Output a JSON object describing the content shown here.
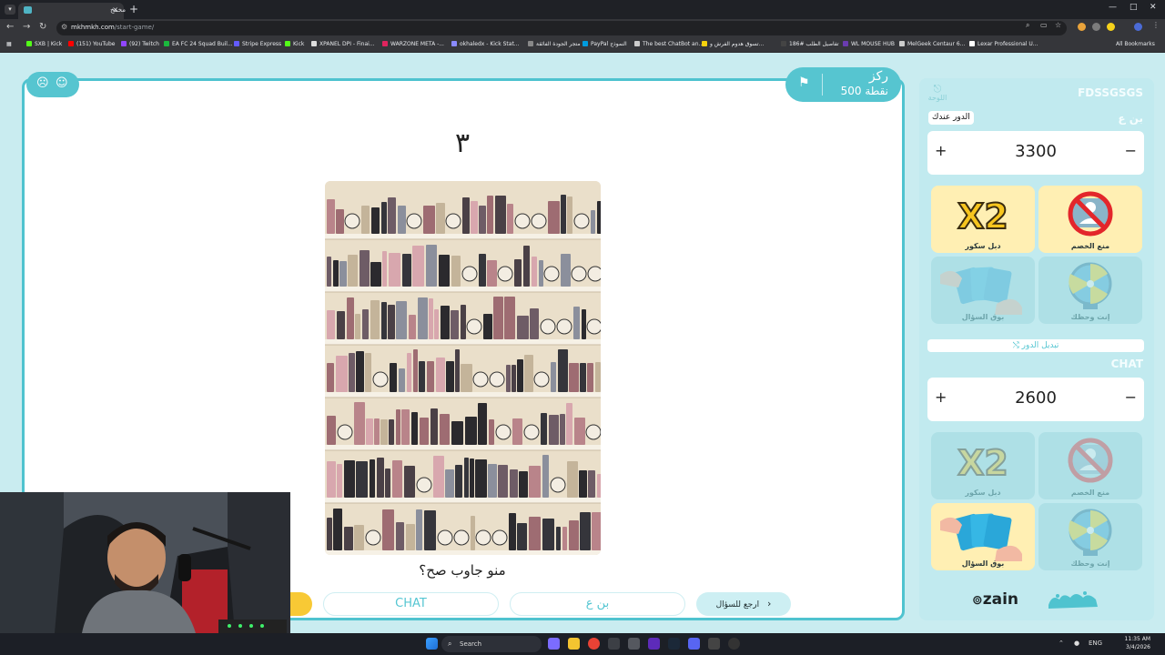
{
  "browser": {
    "tab_title": "مخمخ",
    "tab_close": "×",
    "new_tab": "+",
    "menu": "▾",
    "url_host": "mkhmkh.com",
    "url_path": "/start-game/",
    "window_controls": [
      "—",
      "□",
      "✕"
    ],
    "bookmarks": [
      {
        "label": "SXB | Kick",
        "color": "#53fc18"
      },
      {
        "label": "(151) YouTube",
        "color": "#ff0000"
      },
      {
        "label": "(92) Twitch",
        "color": "#9146ff"
      },
      {
        "label": "EA FC 24 Squad Buil...",
        "color": "#1ab83d"
      },
      {
        "label": "Stripe Express",
        "color": "#635bff"
      },
      {
        "label": "Kick",
        "color": "#53fc18"
      },
      {
        "label": "XPANEL DPI - Finai...",
        "color": "#dddddd"
      },
      {
        "label": "WARZONE META -...",
        "color": "#e0245e"
      },
      {
        "label": "okhaledx - Kick Stat...",
        "color": "#8a8aff"
      },
      {
        "label": "متجر الجودة الفائقة",
        "color": "#888888"
      },
      {
        "label": "PayPal النموذج",
        "color": "#009cde"
      },
      {
        "label": "The best ChatBot an...",
        "color": "#cccccc"
      },
      {
        "label": "تسوق هدوم الفرش و...",
        "color": "#f5d20d"
      },
      {
        "label": "تفاصيل الطلب #186",
        "color": "#444444"
      },
      {
        "label": "WL MOUSE HUB",
        "color": "#6a3cb0"
      },
      {
        "label": "MelGeek Centaur 6...",
        "color": "#cccccc"
      },
      {
        "label": "Lexar Professional U...",
        "color": "#ffffff"
      }
    ],
    "all_bookmarks": "All Bookmarks"
  },
  "game": {
    "emoji_sad": "☹",
    "emoji_happy": "☺",
    "flag_icon": "⚑",
    "category": "ركز",
    "points": "500 نقطة",
    "question_number": "٣",
    "question_text": "منو جاوب صح؟",
    "answer_buttons": [
      "CHAT",
      "بن ع"
    ],
    "back_button": "ارجع للسؤال"
  },
  "side": {
    "board_label": "اللوحة",
    "teams": [
      {
        "name": "FDSSGSGS",
        "sub": "بن ع",
        "turn_label": "الدور عندك",
        "score": "3300",
        "powerups": [
          {
            "label": "منع الخصم",
            "state": "active"
          },
          {
            "label": "دبل سكور",
            "state": "active"
          },
          {
            "label": "إنت وحظك",
            "state": "dim"
          },
          {
            "label": "بوق السؤال",
            "state": "dim"
          }
        ]
      },
      {
        "name": "CHAT",
        "score": "2600",
        "powerups": [
          {
            "label": "منع الخصم",
            "state": "dim"
          },
          {
            "label": "دبل سكور",
            "state": "dim"
          },
          {
            "label": "إنت وحظك",
            "state": "dim"
          },
          {
            "label": "بوق السؤال",
            "state": "active"
          }
        ]
      }
    ],
    "switch_turn": "تبديل الدور",
    "plus": "+",
    "minus": "−",
    "brand_zain": "zain"
  },
  "taskbar": {
    "search": "Search",
    "lang": "ENG",
    "time": "11:35 AM",
    "date": "3/4/2026"
  }
}
